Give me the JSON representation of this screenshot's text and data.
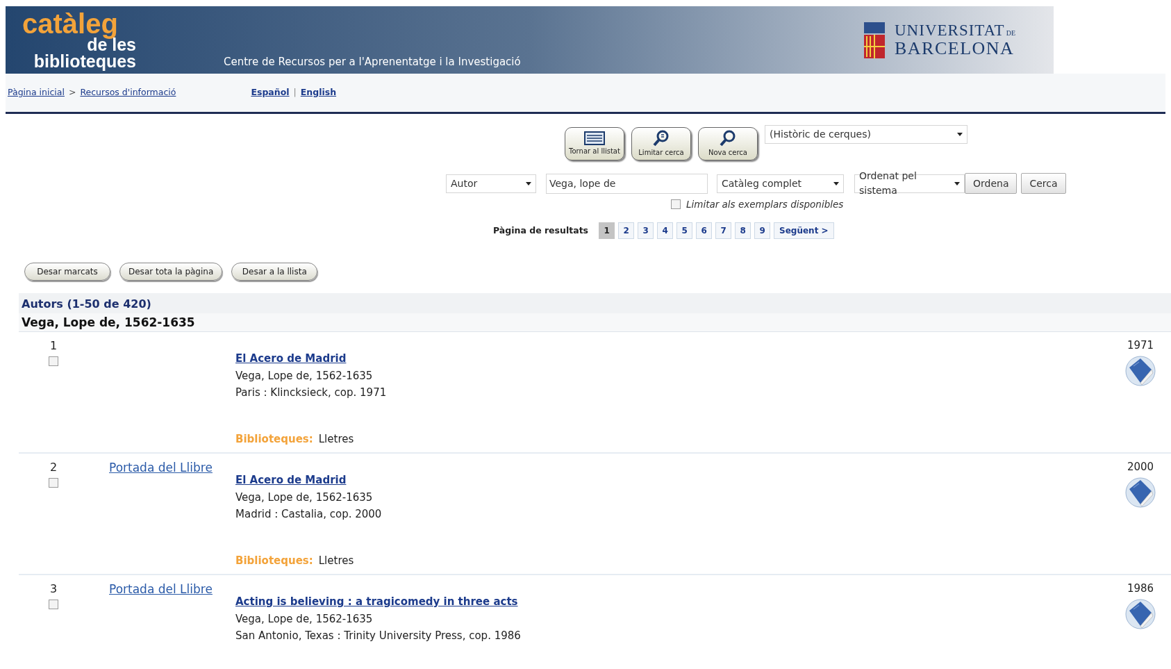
{
  "banner": {
    "logo_lines": [
      "catàleg",
      "de les",
      "biblioteques"
    ],
    "subtitle": "Centre de Recursos per a l'Aprenentatge i la Investigació",
    "university": {
      "line1": "UNIVERSITAT",
      "small": "DE",
      "line2": "BARCELONA"
    }
  },
  "nav": {
    "breadcrumb": [
      "Pàgina inicial",
      "Recursos d'informació"
    ],
    "separator": ">",
    "languages": [
      "Español",
      "English"
    ],
    "language_separator": "|"
  },
  "toolbar": [
    {
      "kind": "list",
      "label": "Tornar al llistat"
    },
    {
      "kind": "limit",
      "label": "Limitar cerca"
    },
    {
      "kind": "search",
      "label": "Nova cerca"
    }
  ],
  "history_select": {
    "value": "(Històric de cerques)"
  },
  "search": {
    "field_select": "Autor",
    "query": "Vega, lope de",
    "catalog_select": "Catàleg complet",
    "sort_select": "Ordenat pel sistema",
    "sort_button": "Ordena",
    "search_button": "Cerca",
    "limit_checkbox": {
      "label": "Limitar als exemplars disponibles",
      "checked": false
    }
  },
  "pagination": {
    "label": "Pàgina de resultats",
    "pages": [
      {
        "label": "1",
        "selected": true
      },
      {
        "label": "2",
        "selected": false
      },
      {
        "label": "3",
        "selected": false
      },
      {
        "label": "4",
        "selected": false
      },
      {
        "label": "5",
        "selected": false
      },
      {
        "label": "6",
        "selected": false
      },
      {
        "label": "7",
        "selected": false
      },
      {
        "label": "8",
        "selected": false
      },
      {
        "label": "9",
        "selected": false
      }
    ],
    "next": "Següent >"
  },
  "save_buttons": [
    "Desar marcats",
    "Desar tota la pàgina",
    "Desar a la llista"
  ],
  "results": {
    "summary": "Autors (1-50 de 420)",
    "heading": "Vega, Lope de, 1562-1635",
    "rows": [
      {
        "number": "1",
        "checked": false,
        "title": "El Acero de Madrid",
        "author": "Vega, Lope de, 1562-1635",
        "publisher": "Paris : Klincksieck, cop. 1971",
        "libraries_label": "Biblioteques:",
        "library": "Lletres",
        "year": "1971"
      },
      {
        "number": "2",
        "checked": false,
        "cover_link": "Portada del Llibre",
        "title": "El Acero de Madrid",
        "author": "Vega, Lope de, 1562-1635",
        "publisher": "Madrid : Castalia, cop. 2000",
        "libraries_label": "Biblioteques:",
        "library": "Lletres",
        "year": "2000"
      },
      {
        "number": "3",
        "checked": false,
        "cover_link": "Portada del Llibre",
        "title": "Acting is believing : a tragicomedy in three acts",
        "author": "Vega, Lope de, 1562-1635",
        "publisher": "San Antonio, Texas : Trinity University Press, cop. 1986",
        "year": "1986"
      }
    ]
  }
}
